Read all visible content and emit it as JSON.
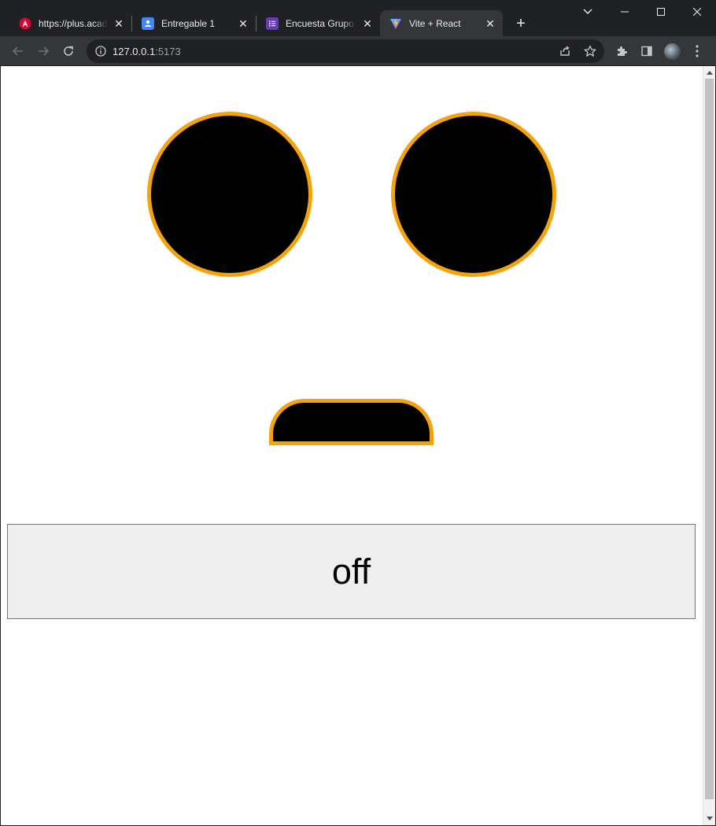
{
  "tabs": [
    {
      "title": "https://plus.acade",
      "favicon": "angular-icon",
      "color": "#dd0031"
    },
    {
      "title": "Entregable 1",
      "favicon": "contact-card-icon",
      "color": "#4285f4"
    },
    {
      "title": "Encuesta Grupo d",
      "favicon": "forms-list-icon",
      "color": "#673ab7"
    },
    {
      "title": "Vite + React",
      "favicon": "vite-icon",
      "color": "#bd34fe",
      "active": true
    }
  ],
  "toolbar": {
    "url_host": "127.0.0.1",
    "url_port": ":5173"
  },
  "page": {
    "toggle_label": "off",
    "colors": {
      "face_outline": "#f5a30d",
      "face_fill": "#000000",
      "button_bg": "#efefef"
    }
  }
}
